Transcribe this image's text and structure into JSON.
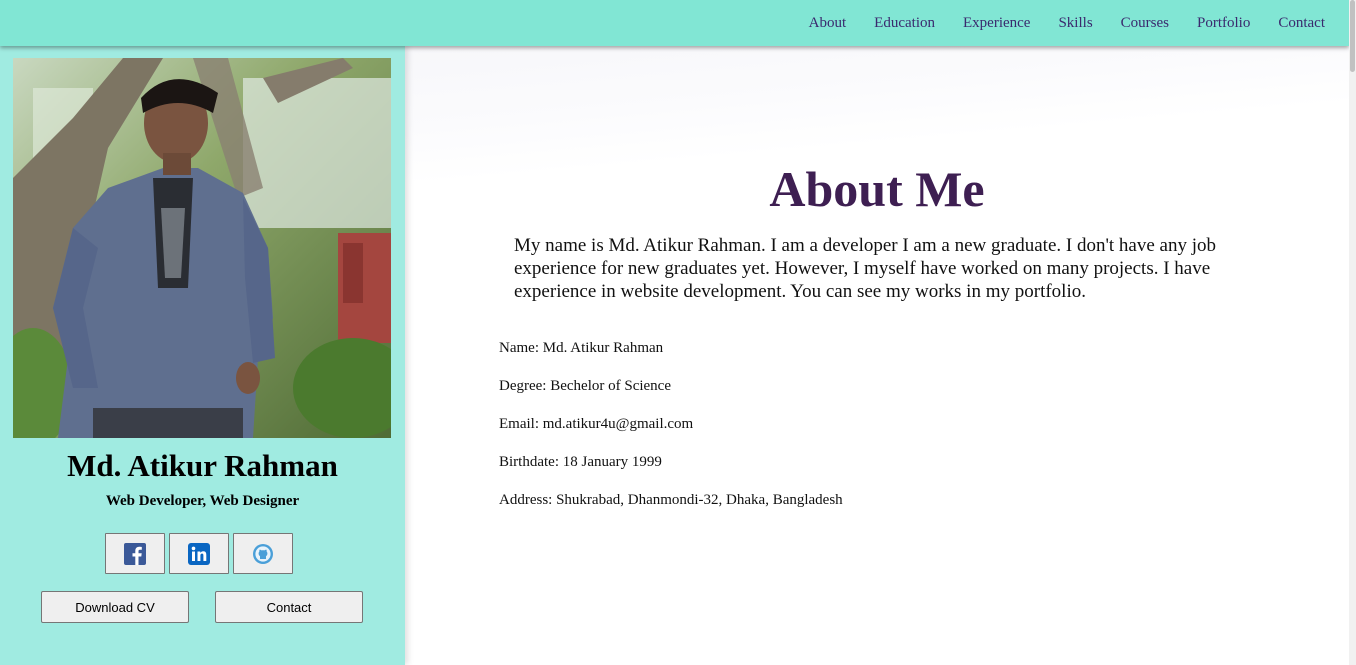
{
  "nav": {
    "items": [
      "About",
      "Education",
      "Experience",
      "Skills",
      "Courses",
      "Portfolio",
      "Contact"
    ]
  },
  "profile": {
    "name": "Md. Atikur Rahman",
    "role": "Web Developer, Web Designer",
    "photo_alt": "profile photo",
    "socials": [
      {
        "icon": "facebook-icon",
        "color": "#3b5998"
      },
      {
        "icon": "linkedin-icon",
        "color": "#0a66c2"
      },
      {
        "icon": "github-icon",
        "color": "#4a9fd8"
      }
    ],
    "download_cv_label": "Download CV",
    "contact_label": "Contact"
  },
  "about": {
    "title": "About Me",
    "text": "My name is Md. Atikur Rahman. I am a developer I am a new graduate. I don't have any job experience for new graduates yet. However, I myself have worked on many projects. I have experience in website development. You can see my works in my portfolio.",
    "info": [
      "Name: Md. Atikur Rahman",
      "Degree: Bechelor of Science",
      "Email: md.atikur4u@gmail.com",
      "Birthdate: 18 January 1999",
      "Address: Shukrabad, Dhanmondi-32, Dhaka, Bangladesh"
    ]
  },
  "colors": {
    "nav_bg": "#81e6d4",
    "sidebar_bg": "#a0ebe1",
    "title": "#3e1f52",
    "nav_text": "#3a2a6e"
  }
}
